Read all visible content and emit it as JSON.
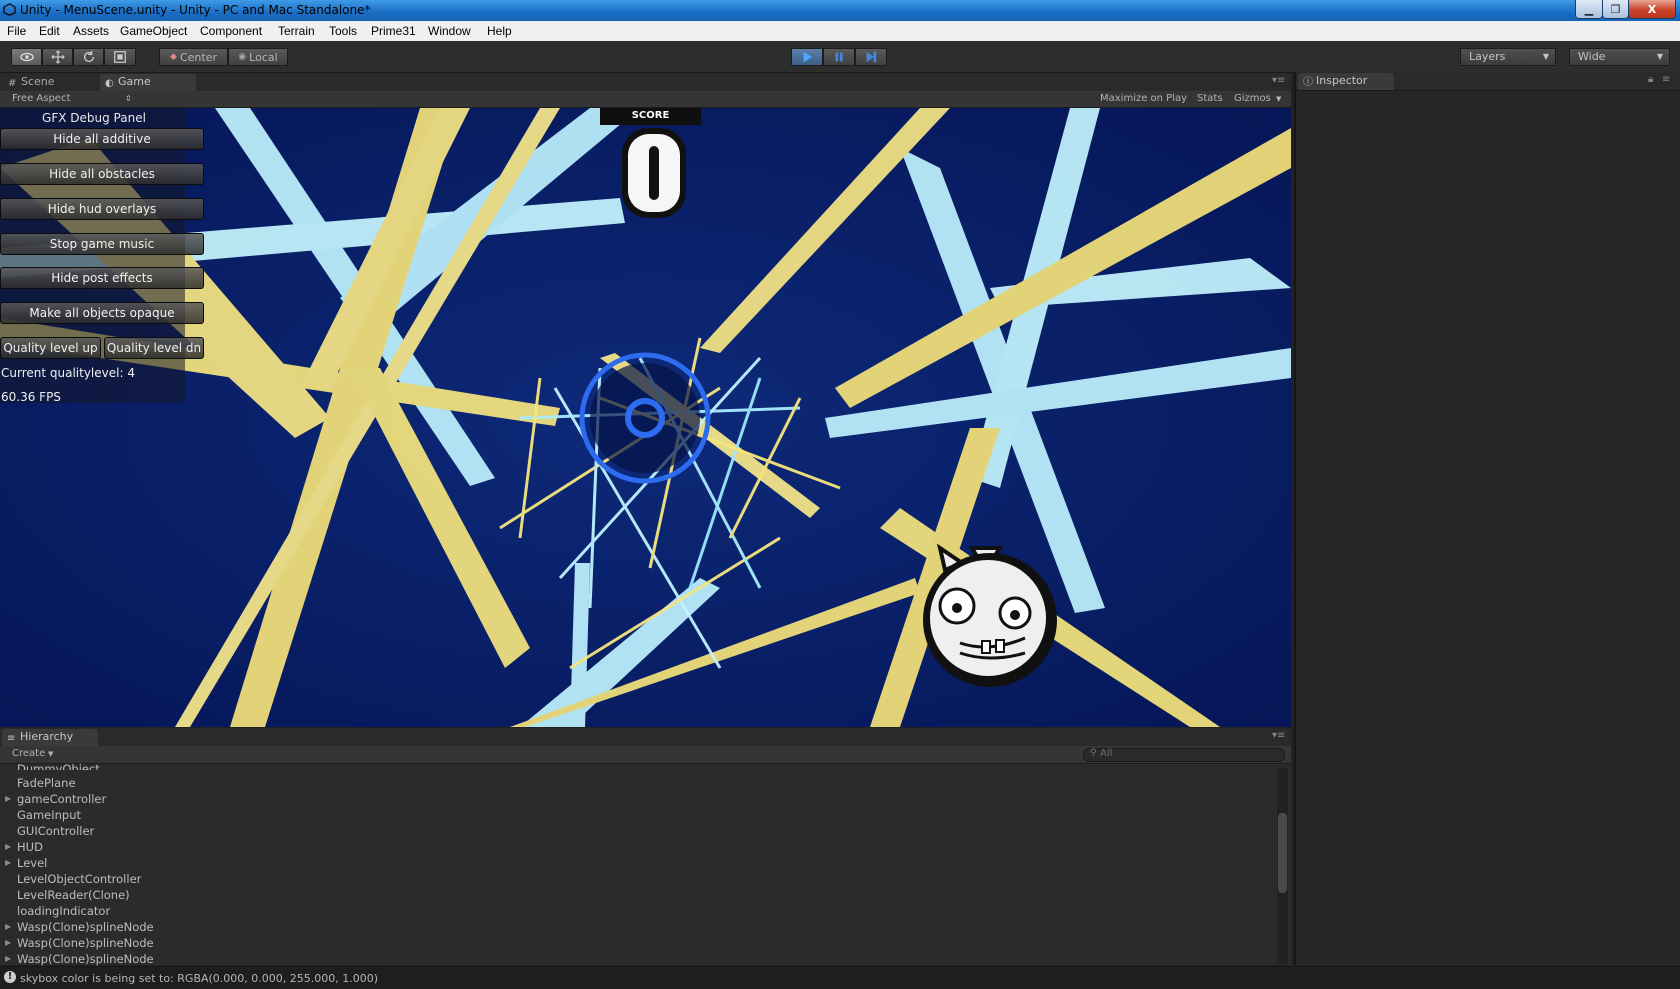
{
  "window": {
    "title": "Unity - MenuScene.unity - Unity - PC and Mac Standalone*",
    "minimize": "▁",
    "maximize": "❐",
    "close": "X"
  },
  "menu": [
    "File",
    "Edit",
    "Assets",
    "GameObject",
    "Component",
    "Terrain",
    "Tools",
    "Prime31",
    "Window",
    "Help"
  ],
  "toolbar": {
    "pivot_mode": "Center",
    "pivot_rotation": "Local",
    "layers": "Layers",
    "layout": "Wide"
  },
  "tabs": {
    "scene": "Scene",
    "game": "Game",
    "inspector": "Inspector",
    "hierarchy": "Hierarchy"
  },
  "game_bar": {
    "aspect": "Free Aspect",
    "maximize_on_play": "Maximize on Play",
    "stats": "Stats",
    "gizmos": "Gizmos"
  },
  "game": {
    "score_label": "SCORE",
    "score_value": "0",
    "debug": {
      "title": "GFX Debug Panel",
      "buttons": [
        "Hide all additive",
        "Hide all obstacles",
        "Hide hud overlays",
        "Stop game music",
        "Hide post effects",
        "Make all objects opaque"
      ],
      "quality_up": "Quality level up",
      "quality_down": "Quality level dn",
      "quality_text": "Current qualitylevel: 4",
      "fps_text": "60.36 FPS"
    }
  },
  "hierarchy": {
    "create": "Create",
    "search_placeholder": "All",
    "items": [
      {
        "name": "DummyObject",
        "expandable": false
      },
      {
        "name": "FadePlane",
        "expandable": false
      },
      {
        "name": "gameController",
        "expandable": true
      },
      {
        "name": "GameInput",
        "expandable": false
      },
      {
        "name": "GUIController",
        "expandable": false
      },
      {
        "name": "HUD",
        "expandable": true
      },
      {
        "name": "Level",
        "expandable": true
      },
      {
        "name": "LevelObjectController",
        "expandable": false
      },
      {
        "name": "LevelReader(Clone)",
        "expandable": false
      },
      {
        "name": "loadingIndicator",
        "expandable": false
      },
      {
        "name": "Wasp(Clone)splineNode",
        "expandable": true
      },
      {
        "name": "Wasp(Clone)splineNode",
        "expandable": true
      },
      {
        "name": "Wasp(Clone)splineNode",
        "expandable": true
      }
    ]
  },
  "status": {
    "message": "skybox color is being set to: RGBA(0.000, 0.000, 255.000, 1.000)"
  },
  "colors": {
    "game_background": "#0c2168",
    "beam_yellow": "#f6e57d",
    "beam_cyan": "#bff3ff",
    "ring_blue": "#2d6cf0",
    "play_active": "#4f7eb3"
  }
}
